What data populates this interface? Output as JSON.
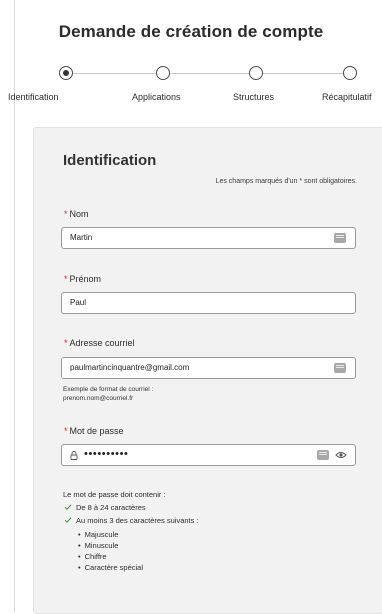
{
  "page": {
    "title": "Demande de création de compte"
  },
  "stepper": {
    "steps": [
      {
        "label": "Identification",
        "active": true
      },
      {
        "label": "Applications",
        "active": false
      },
      {
        "label": "Structures",
        "active": false
      },
      {
        "label": "Récapitulatif",
        "active": false
      }
    ]
  },
  "form": {
    "section_title": "Identification",
    "required_note": "Les champs marqués d'un * sont obligatoires.",
    "required_marker": "*",
    "fields": {
      "nom": {
        "label": "Nom",
        "value": "Martin"
      },
      "prenom": {
        "label": "Prénom",
        "value": "Paul"
      },
      "email": {
        "label": "Adresse courriel",
        "value": "paulmartincinquantre@gmail.com",
        "hint_line1": "Exemple de format de courriel :",
        "hint_line2": "prenom.nom@courriel.fr"
      },
      "password": {
        "label": "Mot de passe",
        "value": "••••••••••"
      }
    },
    "password_rules": {
      "title": "Le mot de passe doit contenir :",
      "rule1": "De 8 à 24 caractères",
      "rule2": "Au moins 3 des caractères suivants :",
      "items": [
        "Majuscule",
        "Minuscule",
        "Chiffre",
        "Caractère spécial"
      ]
    }
  },
  "icons": {
    "check": "check-icon",
    "keyboard": "keyboard-icon",
    "lock": "lock-icon",
    "eye": "eye-icon"
  },
  "colors": {
    "required_star": "#c42a2a",
    "check_green": "#2f8f3a",
    "card_background": "#f2f2f2"
  }
}
